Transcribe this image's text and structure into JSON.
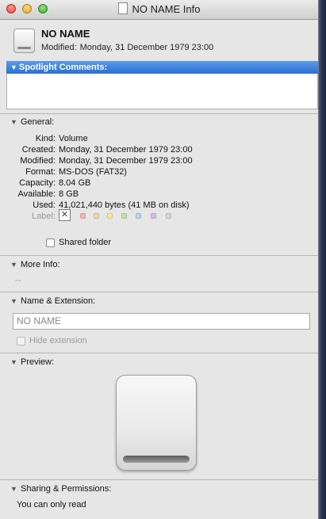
{
  "window": {
    "title": "NO NAME Info"
  },
  "header": {
    "name": "NO NAME",
    "modified_label": "Modified:",
    "modified_value": "Monday, 31 December 1979 23:00"
  },
  "spotlight": {
    "title": "Spotlight Comments:",
    "value": ""
  },
  "general": {
    "title": "General:",
    "rows": [
      {
        "key": "Kind:",
        "value": "Volume"
      },
      {
        "key": "Created:",
        "value": "Monday, 31 December 1979 23:00"
      },
      {
        "key": "Modified:",
        "value": "Monday, 31 December 1979 23:00"
      },
      {
        "key": "Format:",
        "value": "MS-DOS (FAT32)"
      },
      {
        "key": "Capacity:",
        "value": "8.04 GB"
      },
      {
        "key": "Available:",
        "value": "8 GB"
      },
      {
        "key": "Used:",
        "value": "41,021,440 bytes (41 MB on disk)"
      }
    ],
    "label_key": "Label:",
    "label_colors": [
      "#f3b6b6",
      "#f6d3a9",
      "#f2ec9e",
      "#bfe3ac",
      "#b9d3f3",
      "#d7bdeb",
      "#d6d6d6"
    ],
    "shared_folder_label": "Shared folder"
  },
  "more_info": {
    "title": "More Info:",
    "value": "--"
  },
  "name_extension": {
    "title": "Name & Extension:",
    "name_value": "NO NAME",
    "hide_extension_label": "Hide extension"
  },
  "preview": {
    "title": "Preview:"
  },
  "sharing": {
    "title": "Sharing & Permissions:",
    "status": "You can only read"
  },
  "icons": {
    "disclosure_open": "▼",
    "label_none": "✕"
  }
}
